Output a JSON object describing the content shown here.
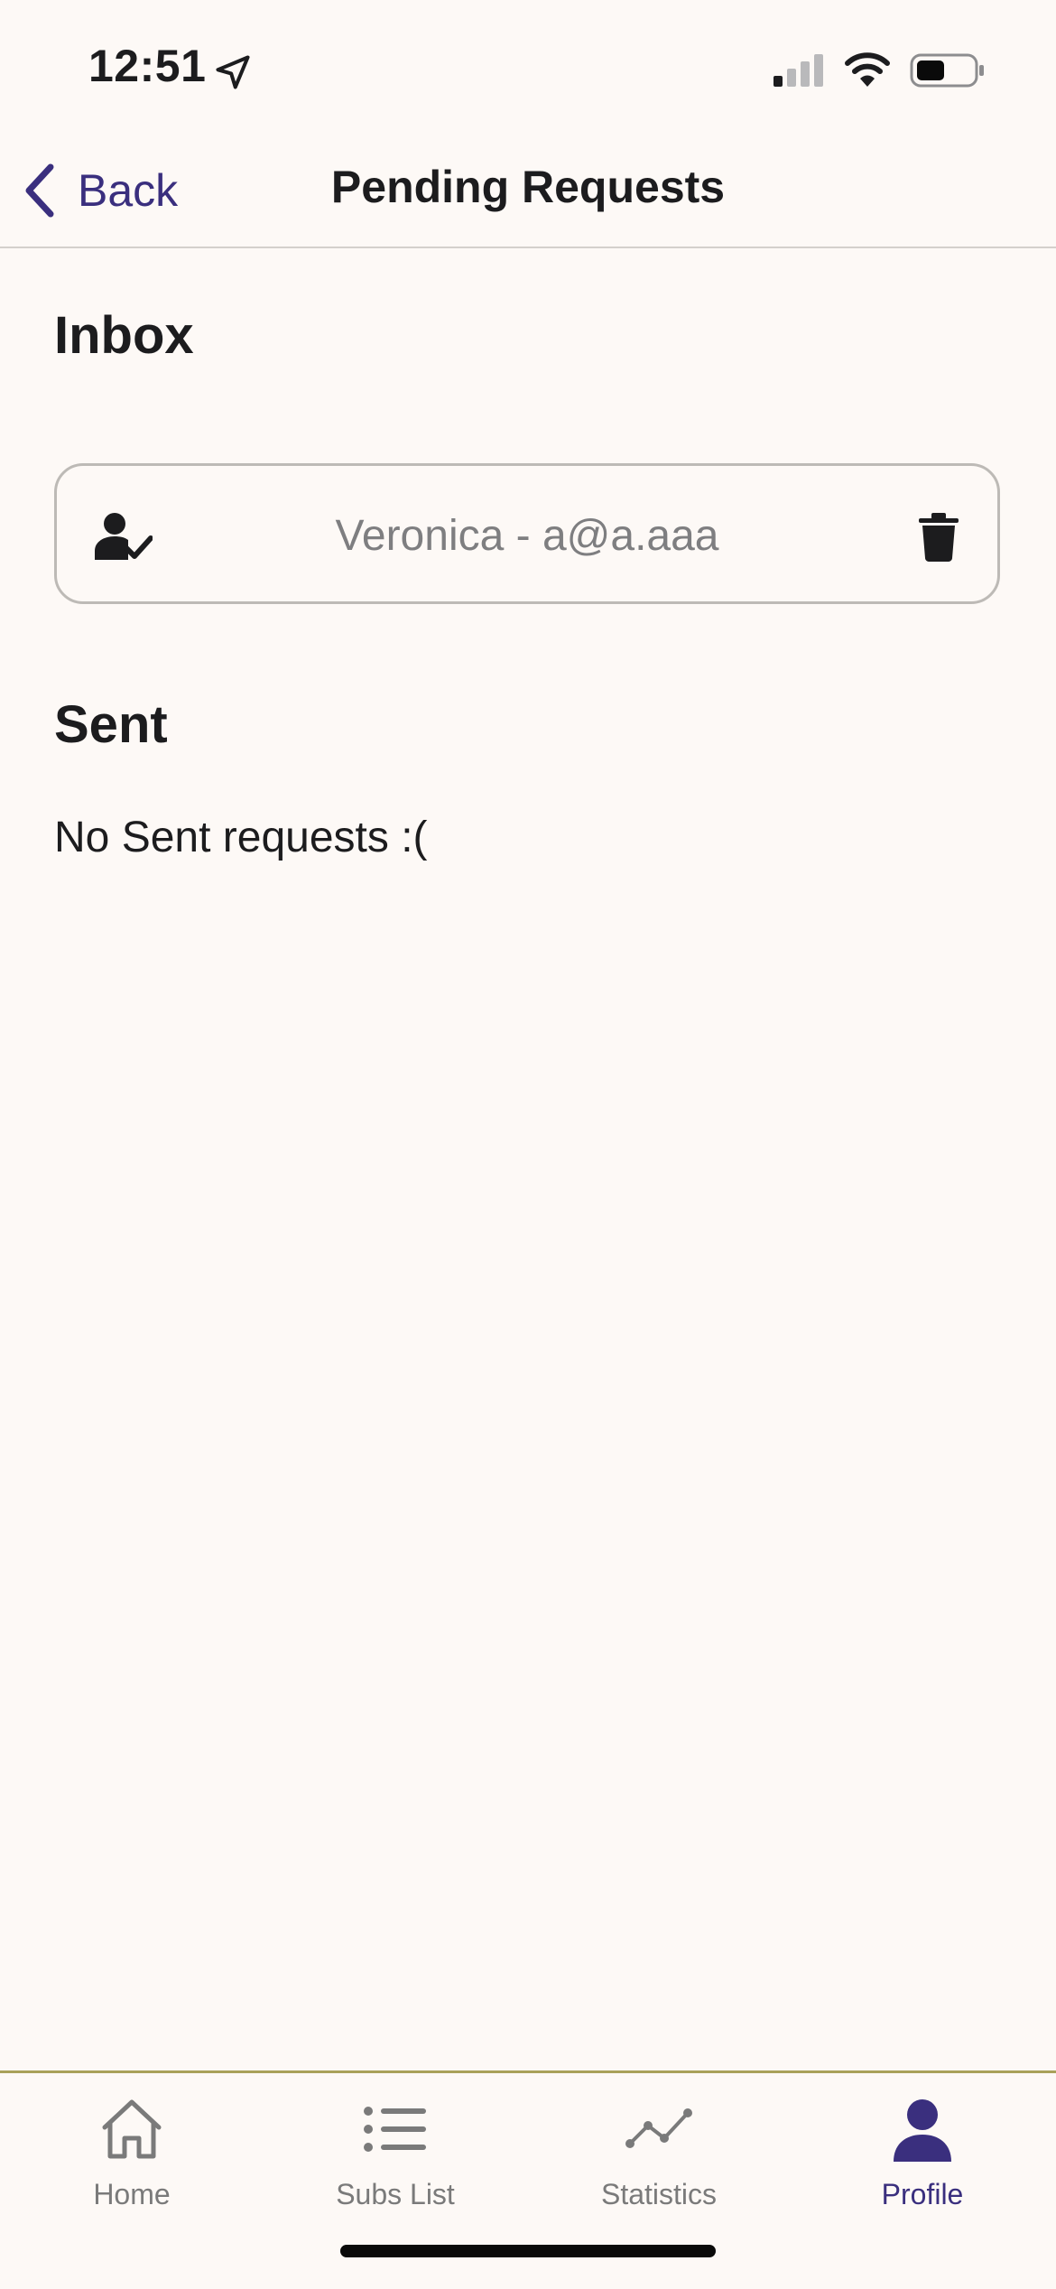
{
  "status_bar": {
    "time": "12:51"
  },
  "nav": {
    "back_label": "Back",
    "title": "Pending Requests"
  },
  "inbox": {
    "heading": "Inbox",
    "requests": [
      {
        "text": "Veronica - a@a.aaa"
      }
    ]
  },
  "sent": {
    "heading": "Sent",
    "empty_message": "No Sent requests :("
  },
  "tab_bar": {
    "tabs": [
      {
        "label": "Home",
        "icon": "home-icon",
        "active": false
      },
      {
        "label": "Subs List",
        "icon": "list-icon",
        "active": false
      },
      {
        "label": "Statistics",
        "icon": "chart-line-icon",
        "active": false
      },
      {
        "label": "Profile",
        "icon": "person-icon",
        "active": true
      }
    ]
  },
  "colors": {
    "accent": "#3a2f7e",
    "background": "#fdf9f6",
    "tab_divider": "#a9a15a",
    "inactive": "#7a7a7a"
  }
}
